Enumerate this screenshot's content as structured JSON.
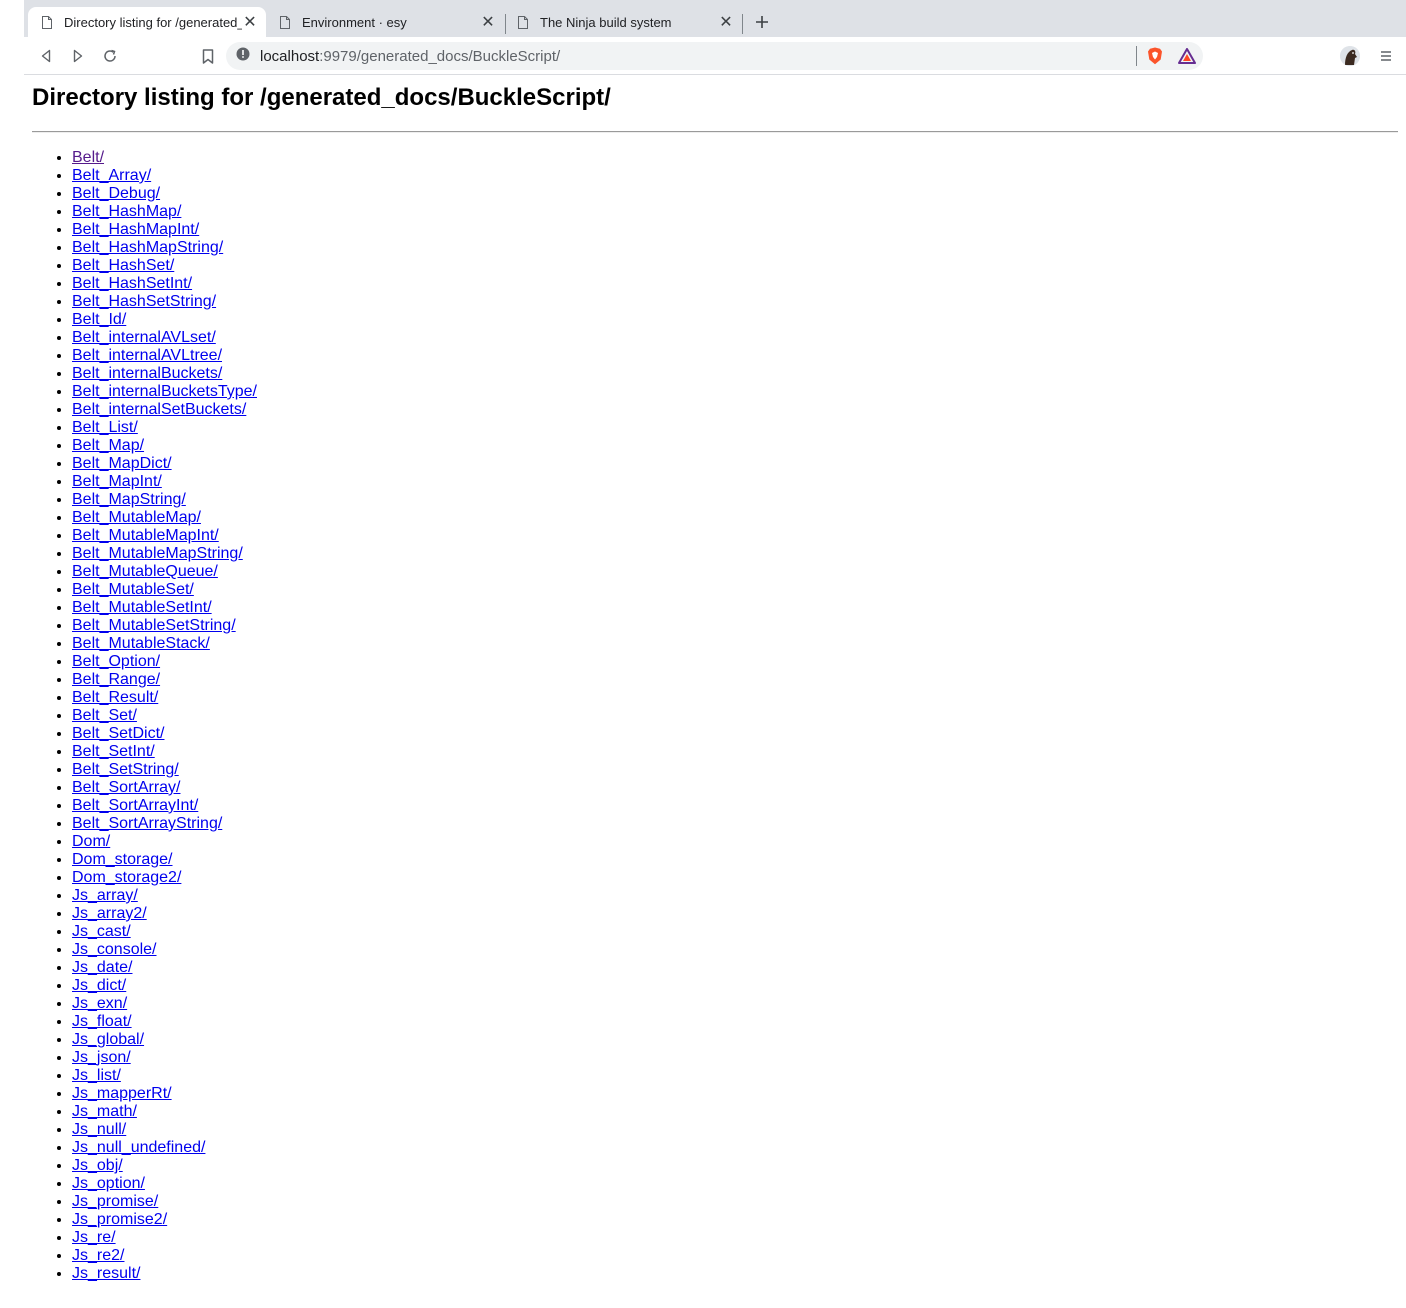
{
  "browser": {
    "tabs": [
      {
        "title": "Directory listing for /generated_docs/BuckleScript/",
        "active": true
      },
      {
        "title": "Environment · esy",
        "active": false
      },
      {
        "title": "The Ninja build system",
        "active": false
      }
    ],
    "address_bar": {
      "host": "localhost",
      "rest": ":9979/generated_docs/BuckleScript/"
    }
  },
  "page": {
    "heading": "Directory listing for /generated_docs/BuckleScript/",
    "entries": [
      {
        "label": "Belt/",
        "visited": true
      },
      {
        "label": "Belt_Array/"
      },
      {
        "label": "Belt_Debug/"
      },
      {
        "label": "Belt_HashMap/"
      },
      {
        "label": "Belt_HashMapInt/"
      },
      {
        "label": "Belt_HashMapString/"
      },
      {
        "label": "Belt_HashSet/"
      },
      {
        "label": "Belt_HashSetInt/"
      },
      {
        "label": "Belt_HashSetString/"
      },
      {
        "label": "Belt_Id/"
      },
      {
        "label": "Belt_internalAVLset/"
      },
      {
        "label": "Belt_internalAVLtree/"
      },
      {
        "label": "Belt_internalBuckets/"
      },
      {
        "label": "Belt_internalBucketsType/"
      },
      {
        "label": "Belt_internalSetBuckets/"
      },
      {
        "label": "Belt_List/"
      },
      {
        "label": "Belt_Map/"
      },
      {
        "label": "Belt_MapDict/"
      },
      {
        "label": "Belt_MapInt/"
      },
      {
        "label": "Belt_MapString/"
      },
      {
        "label": "Belt_MutableMap/"
      },
      {
        "label": "Belt_MutableMapInt/"
      },
      {
        "label": "Belt_MutableMapString/"
      },
      {
        "label": "Belt_MutableQueue/"
      },
      {
        "label": "Belt_MutableSet/"
      },
      {
        "label": "Belt_MutableSetInt/"
      },
      {
        "label": "Belt_MutableSetString/"
      },
      {
        "label": "Belt_MutableStack/"
      },
      {
        "label": "Belt_Option/"
      },
      {
        "label": "Belt_Range/"
      },
      {
        "label": "Belt_Result/"
      },
      {
        "label": "Belt_Set/"
      },
      {
        "label": "Belt_SetDict/"
      },
      {
        "label": "Belt_SetInt/"
      },
      {
        "label": "Belt_SetString/"
      },
      {
        "label": "Belt_SortArray/"
      },
      {
        "label": "Belt_SortArrayInt/"
      },
      {
        "label": "Belt_SortArrayString/"
      },
      {
        "label": "Dom/"
      },
      {
        "label": "Dom_storage/"
      },
      {
        "label": "Dom_storage2/"
      },
      {
        "label": "Js_array/"
      },
      {
        "label": "Js_array2/"
      },
      {
        "label": "Js_cast/"
      },
      {
        "label": "Js_console/"
      },
      {
        "label": "Js_date/"
      },
      {
        "label": "Js_dict/"
      },
      {
        "label": "Js_exn/"
      },
      {
        "label": "Js_float/"
      },
      {
        "label": "Js_global/"
      },
      {
        "label": "Js_json/"
      },
      {
        "label": "Js_list/"
      },
      {
        "label": "Js_mapperRt/"
      },
      {
        "label": "Js_math/"
      },
      {
        "label": "Js_null/"
      },
      {
        "label": "Js_null_undefined/"
      },
      {
        "label": "Js_obj/"
      },
      {
        "label": "Js_option/"
      },
      {
        "label": "Js_promise/"
      },
      {
        "label": "Js_promise2/"
      },
      {
        "label": "Js_re/"
      },
      {
        "label": "Js_re2/"
      },
      {
        "label": "Js_result/"
      }
    ]
  },
  "colors": {
    "link": "#0000ee",
    "visited_link": "#551a8b",
    "tabstrip": "#dee1e6",
    "omnibox": "#f1f3f4"
  }
}
